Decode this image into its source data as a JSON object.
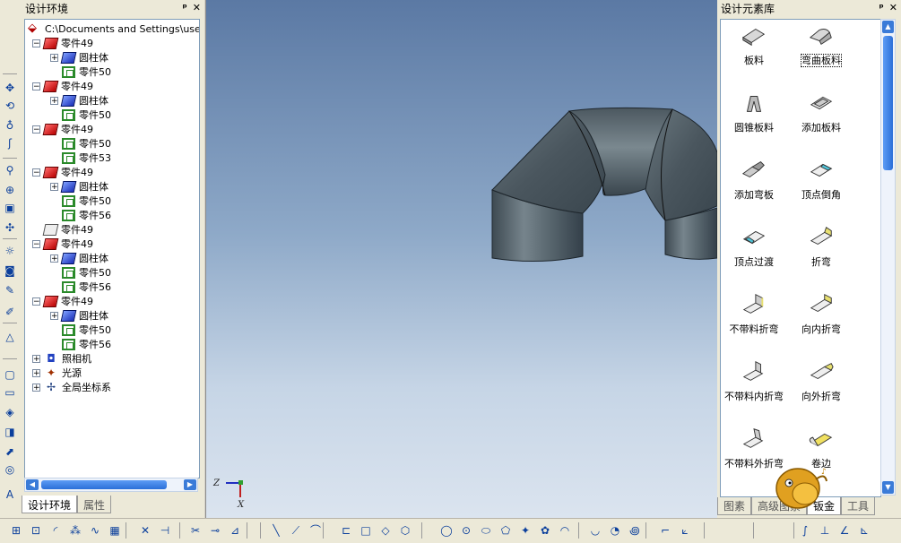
{
  "left_toolbar": {
    "icons": [
      "move-icon",
      "rotate-icon",
      "orbit-icon",
      "walk-icon",
      "zoom-icon",
      "zoom-window-icon",
      "camera-icon",
      "pan-icon",
      "light-icon",
      "snapshot-icon",
      "render-icon",
      "sketch-icon",
      "measure-icon",
      "face-icon",
      "section-icon",
      "view-icon",
      "rotate-view-icon",
      "arrow-icon",
      "circle-icon",
      "text-icon"
    ]
  },
  "tree_panel": {
    "title": "设计环境",
    "pin": "ᵖ",
    "close": "✕",
    "root": "C:\\Documents and Settings\\user\\桌",
    "rows": [
      {
        "indent": 1,
        "expander": "−",
        "icon": "red",
        "label": "零件49"
      },
      {
        "indent": 2,
        "expander": "+",
        "icon": "blue",
        "label": "圆柱体"
      },
      {
        "indent": 2,
        "expander": "",
        "icon": "green",
        "label": "零件50"
      },
      {
        "indent": 1,
        "expander": "−",
        "icon": "red",
        "label": "零件49"
      },
      {
        "indent": 2,
        "expander": "+",
        "icon": "blue",
        "label": "圆柱体"
      },
      {
        "indent": 2,
        "expander": "",
        "icon": "green",
        "label": "零件50"
      },
      {
        "indent": 1,
        "expander": "−",
        "icon": "red",
        "label": "零件49"
      },
      {
        "indent": 2,
        "expander": "",
        "icon": "green",
        "label": "零件50"
      },
      {
        "indent": 2,
        "expander": "",
        "icon": "green",
        "label": "零件53"
      },
      {
        "indent": 1,
        "expander": "−",
        "icon": "red",
        "label": "零件49"
      },
      {
        "indent": 2,
        "expander": "+",
        "icon": "blue",
        "label": "圆柱体"
      },
      {
        "indent": 2,
        "expander": "",
        "icon": "green",
        "label": "零件50"
      },
      {
        "indent": 2,
        "expander": "",
        "icon": "green",
        "label": "零件56"
      },
      {
        "indent": 1,
        "expander": "",
        "icon": "gray",
        "label": "零件49"
      },
      {
        "indent": 1,
        "expander": "−",
        "icon": "red",
        "label": "零件49"
      },
      {
        "indent": 2,
        "expander": "+",
        "icon": "blue",
        "label": "圆柱体"
      },
      {
        "indent": 2,
        "expander": "",
        "icon": "green",
        "label": "零件50"
      },
      {
        "indent": 2,
        "expander": "",
        "icon": "green",
        "label": "零件56"
      },
      {
        "indent": 1,
        "expander": "−",
        "icon": "red",
        "label": "零件49"
      },
      {
        "indent": 2,
        "expander": "+",
        "icon": "blue",
        "label": "圆柱体"
      },
      {
        "indent": 2,
        "expander": "",
        "icon": "green",
        "label": "零件50"
      },
      {
        "indent": 2,
        "expander": "",
        "icon": "green",
        "label": "零件56"
      },
      {
        "indent": 1,
        "expander": "+",
        "icon": "camera",
        "label": "照相机"
      },
      {
        "indent": 1,
        "expander": "+",
        "icon": "light",
        "label": "光源"
      },
      {
        "indent": 1,
        "expander": "+",
        "icon": "axis",
        "label": "全局坐标系"
      }
    ],
    "tabs": [
      "设计环境",
      "属性"
    ]
  },
  "viewport": {
    "axis_x": "X",
    "axis_z": "Z"
  },
  "library_panel": {
    "title": "设计元素库",
    "pin": "ᵖ",
    "close": "✕",
    "items": [
      {
        "label": "板料",
        "selected": false
      },
      {
        "label": "弯曲板料",
        "selected": true
      },
      {
        "label": "圆锥板料",
        "selected": false
      },
      {
        "label": "添加板料",
        "selected": false
      },
      {
        "label": "添加弯板",
        "selected": false
      },
      {
        "label": "顶点倒角",
        "selected": false
      },
      {
        "label": "顶点过渡",
        "selected": false
      },
      {
        "label": "折弯",
        "selected": false
      },
      {
        "label": "不带料折弯",
        "selected": false
      },
      {
        "label": "向内折弯",
        "selected": false
      },
      {
        "label": "不带料内折弯",
        "selected": false
      },
      {
        "label": "向外折弯",
        "selected": false
      },
      {
        "label": "不带料外折弯",
        "selected": false
      },
      {
        "label": "卷边",
        "selected": false
      }
    ],
    "tabs": [
      "图素",
      "高级图素",
      "钣金",
      "工具"
    ]
  },
  "bottom_toolbar": {
    "icons": [
      "grid-icon",
      "box-icon",
      "arc-icon",
      "pattern-icon",
      "spline-icon",
      "stamp-icon",
      "cut-icon",
      "trim-icon",
      "break-icon",
      "extend-icon",
      "mirror-icon",
      "line-icon",
      "polyline-icon",
      "curve-icon",
      "offset-icon",
      "rect-icon",
      "diamond-icon",
      "hexagon-icon",
      "circle-icon",
      "circle-center-icon",
      "ellipse-icon",
      "polygon-icon",
      "star-icon",
      "gear-icon",
      "arc-3pt-icon",
      "arc-tangent-icon",
      "arc-center-icon",
      "spiral-icon",
      "fillet-icon",
      "chamfer-icon",
      "bspline-icon",
      "dimension-icon",
      "angle-icon",
      "constraint-icon"
    ]
  }
}
